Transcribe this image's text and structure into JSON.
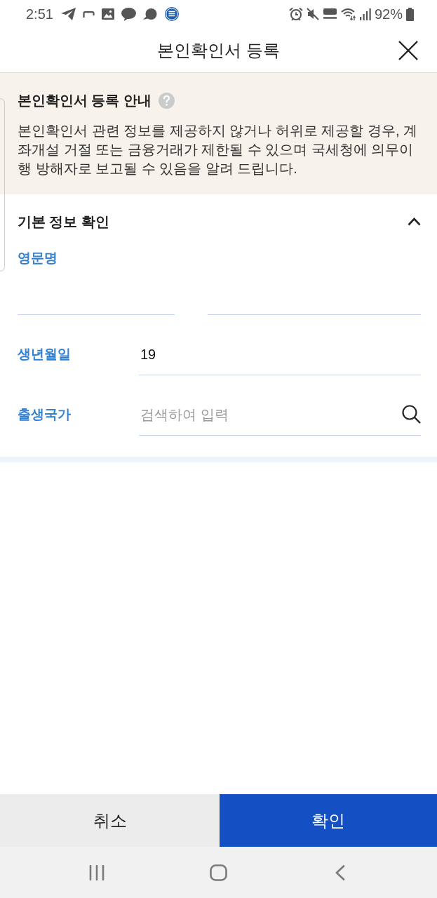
{
  "status_bar": {
    "time": "2:51",
    "battery": "92%"
  },
  "header": {
    "title": "본인확인서 등록"
  },
  "notice": {
    "title": "본인확인서 등록 안내",
    "text": "본인확인서 관련 정보를 제공하지 않거나 허위로 제공할 경우, 계좌개설 거절 또는 금융거래가 제한될 수 있으며 국세청에 의무이행 방해자로 보고될 수 있음을 알려 드립니다."
  },
  "section": {
    "title": "기본 정보 확인",
    "expanded": true,
    "fields": [
      {
        "kind": "name_pair",
        "label": "영문명"
      },
      {
        "kind": "text",
        "label": "생년월일",
        "value": "19"
      },
      {
        "kind": "search",
        "label": "출생국가",
        "placeholder": "검색하여 입력"
      }
    ]
  },
  "buttons": [
    {
      "kind": "secondary",
      "label": "취소"
    },
    {
      "kind": "primary",
      "label": "확인"
    }
  ]
}
